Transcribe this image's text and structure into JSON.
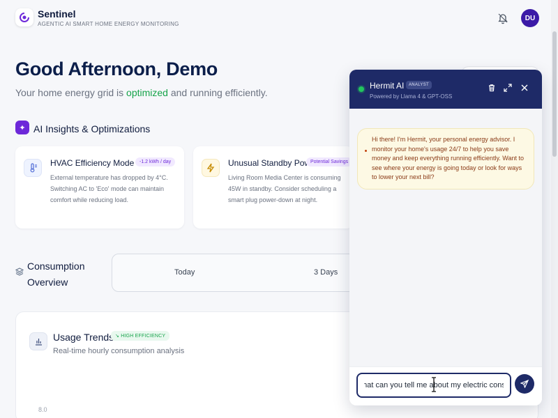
{
  "header": {
    "brand_name": "Sentinel",
    "brand_subtitle": "AGENTIC AI SMART HOME ENERGY MONITORING",
    "avatar_initials": "DU",
    "icons": [
      "sentinel-logo-icon",
      "bell-icon"
    ]
  },
  "greeting": {
    "title": "Good Afternoon, Demo",
    "subtitle_pre": "Your home energy grid is ",
    "subtitle_status": "optimized",
    "subtitle_post": " and running efficiently."
  },
  "insights": {
    "section_title": "AI Insights & Optimizations",
    "cards": [
      {
        "title": "HVAC Efficiency Mode",
        "badge": "-1.2 kWh / day",
        "text": "External temperature has dropped by 4°C. Switching AC to 'Eco' mode can maintain comfort while reducing load.",
        "icon": "thermometer-snow-icon"
      },
      {
        "title": "Unusual Standby Power",
        "badge": "Potential Savings",
        "text": "Living Room Media Center is consuming 45W in standby. Consider scheduling a smart plug power-down at night.",
        "icon": "lightning-icon"
      }
    ]
  },
  "consumption": {
    "title_line1": "Consumption",
    "title_line2": "Overview",
    "ranges": [
      "Today",
      "3 Days"
    ]
  },
  "usage": {
    "title": "Usage Trends",
    "badge": "HIGH EFFICIENCY",
    "subtitle": "Real-time hourly consumption analysis",
    "y_tick": "8.0"
  },
  "chat": {
    "name": "Hermit AI",
    "badge": "ANALYST",
    "powered_by": "Powered by Llama 4 & GPT-OSS",
    "message": "Hi there! I'm Hermit, your personal energy advisor. I monitor your home's usage 24/7 to help you save money and keep everything running efficiently. Want to see where your energy is going today or look for ways to lower your next bill?",
    "input_value": "'hat can you tell me about my electric consu",
    "colors": {
      "header": "#1e2a67",
      "accent": "#3b1aa7",
      "online": "#22c55e"
    }
  }
}
